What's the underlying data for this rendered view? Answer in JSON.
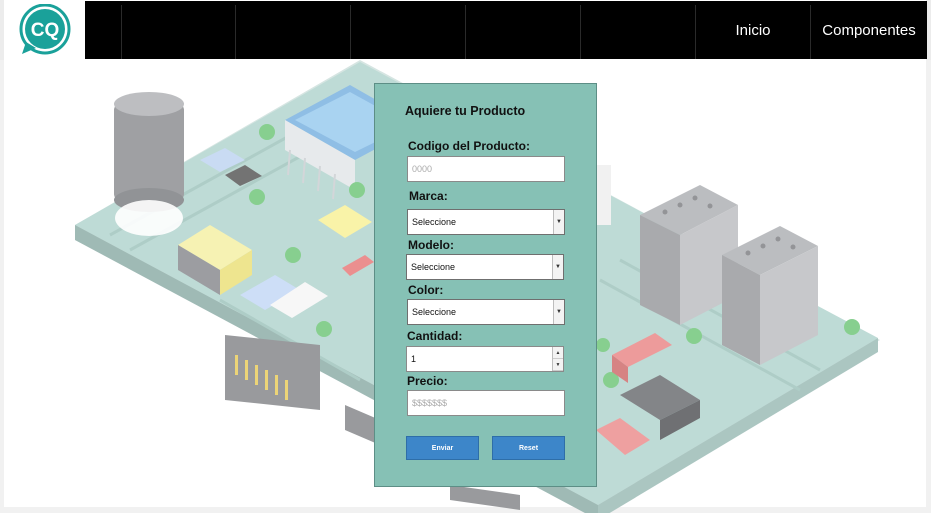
{
  "logo": {
    "text": "CQ"
  },
  "nav": {
    "inicio": "Inicio",
    "componentes": "Componentes"
  },
  "form": {
    "title": "Aquiere tu Producto",
    "codigo": {
      "label": "Codigo del Producto:",
      "placeholder": "0000"
    },
    "marca": {
      "label": "Marca:",
      "selected": "Seleccione"
    },
    "modelo": {
      "label": "Modelo:",
      "selected": "Seleccione"
    },
    "color": {
      "label": "Color:",
      "selected": "Seleccione"
    },
    "cantidad": {
      "label": "Cantidad:",
      "value": "1"
    },
    "precio": {
      "label": "Precio:",
      "placeholder": "$$$$$$$"
    },
    "enviar": "Enviar",
    "reset": "Reset"
  },
  "colors": {
    "nav_bg": "#000000",
    "form_bg": "#86c1b5",
    "button": "#3d86c9",
    "logo": "#1aa19a"
  }
}
